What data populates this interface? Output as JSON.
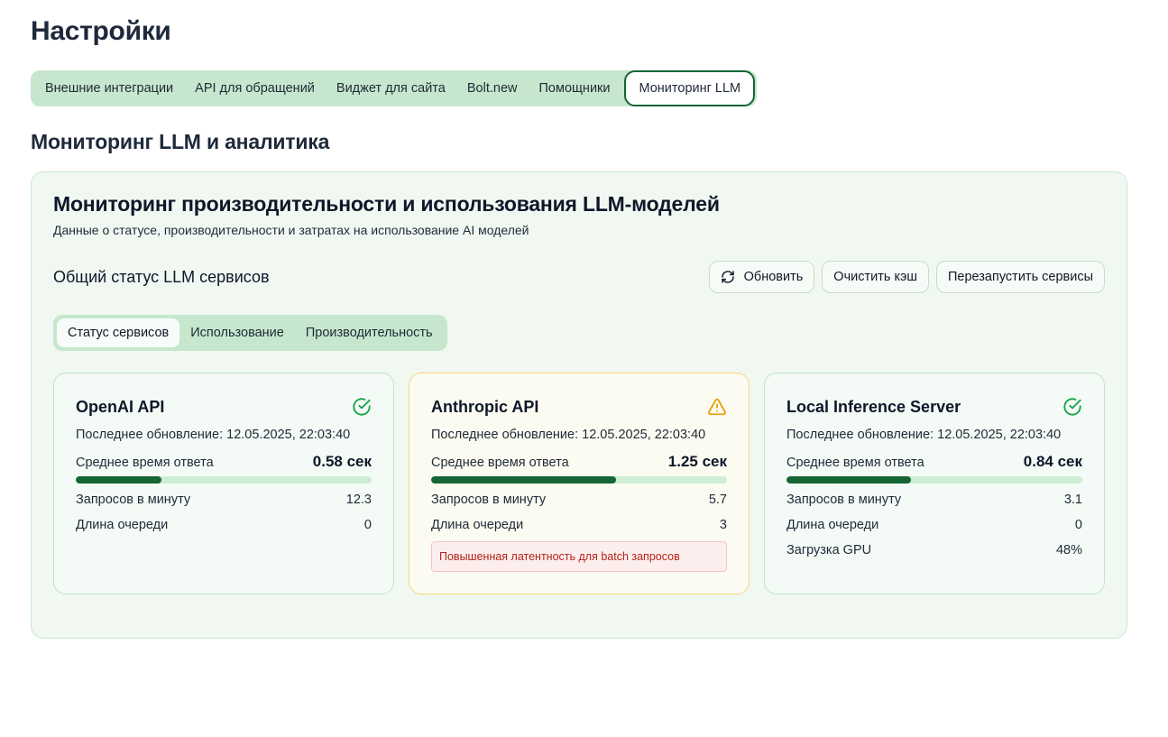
{
  "page": {
    "title": "Настройки"
  },
  "top_tabs": [
    {
      "label": "Внешние интеграции",
      "active": false
    },
    {
      "label": "API для обращений",
      "active": false
    },
    {
      "label": "Виджет для сайта",
      "active": false
    },
    {
      "label": "Bolt.new",
      "active": false
    },
    {
      "label": "Помощники",
      "active": false
    },
    {
      "label": "Мониторинг LLM",
      "active": true
    }
  ],
  "section": {
    "title": "Мониторинг LLM и аналитика"
  },
  "panel": {
    "title": "Мониторинг производительности и использования LLM-моделей",
    "subtitle": "Данные о статусе, производительности и затратах на использование AI моделей",
    "status_heading": "Общий статус LLM сервисов",
    "actions": {
      "refresh": "Обновить",
      "clear_cache": "Очистить кэш",
      "restart": "Перезапустить сервисы"
    },
    "sub_tabs": [
      {
        "label": "Статус сервисов",
        "active": true
      },
      {
        "label": "Использование",
        "active": false
      },
      {
        "label": "Производительность",
        "active": false
      }
    ]
  },
  "labels": {
    "updated_prefix": "Последнее обновление: ",
    "avg_response": "Среднее время ответа",
    "rpm": "Запросов в минуту",
    "queue": "Длина очереди",
    "gpu": "Загрузка GPU"
  },
  "services": [
    {
      "name": "OpenAI API",
      "status": "ok",
      "status_icon": "check-circle-icon",
      "updated": "12.05.2025, 22:03:40",
      "avg_response": "0.58 сек",
      "response_fraction": 0.29,
      "rpm": "12.3",
      "queue": "0"
    },
    {
      "name": "Anthropic API",
      "status": "warning",
      "status_icon": "warning-triangle-icon",
      "updated": "12.05.2025, 22:03:40",
      "avg_response": "1.25 сек",
      "response_fraction": 0.625,
      "rpm": "5.7",
      "queue": "3",
      "alert": "Повышенная латентность для batch запросов"
    },
    {
      "name": "Local Inference Server",
      "status": "ok",
      "status_icon": "check-circle-icon",
      "updated": "12.05.2025, 22:03:40",
      "avg_response": "0.84 сек",
      "response_fraction": 0.42,
      "rpm": "3.1",
      "queue": "0",
      "gpu": "48%"
    }
  ],
  "colors": {
    "accent": "#166534",
    "ok": "#16a34a",
    "warning": "#e5a00d",
    "alert_text": "#b42318"
  }
}
